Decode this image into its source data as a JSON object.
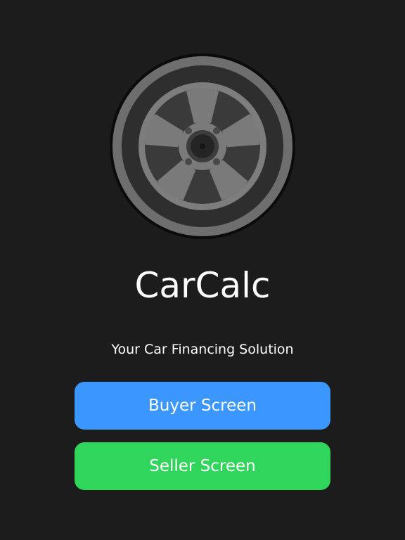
{
  "app": {
    "title": "CarCalc",
    "subtitle": "Your Car Financing Solution",
    "logo_icon": "car-wheel-icon"
  },
  "buttons": {
    "buyer_label": "Buyer Screen",
    "seller_label": "Seller Screen"
  },
  "colors": {
    "background": "#1c1c1c",
    "buyer_button": "#3b96fd",
    "seller_button": "#2fd65b",
    "text": "#ffffff"
  }
}
